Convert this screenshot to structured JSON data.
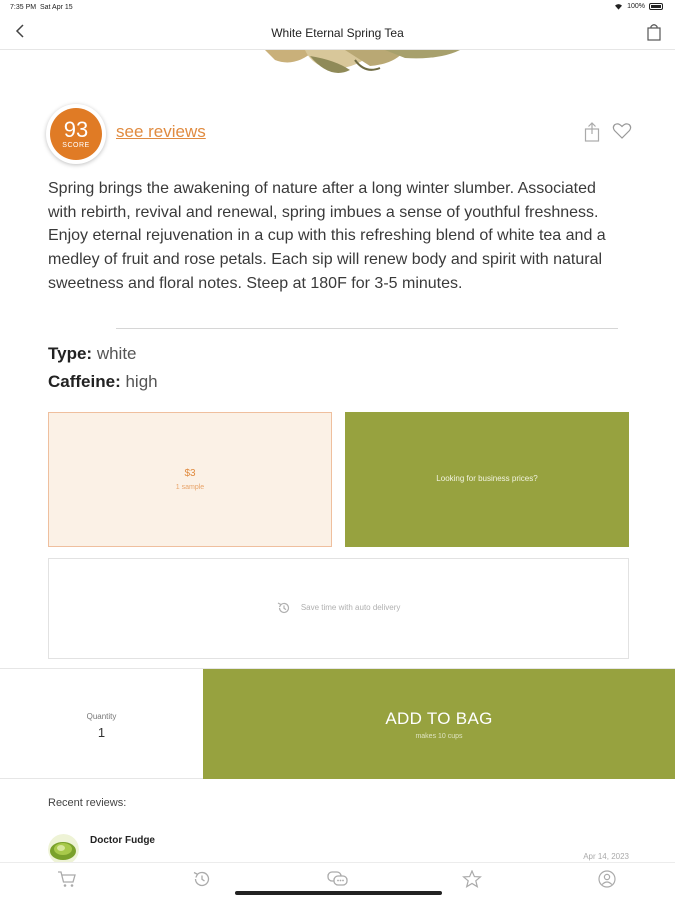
{
  "status": {
    "time": "7:35 PM",
    "date": "Sat Apr 15",
    "battery": "100%"
  },
  "nav": {
    "title": "White Eternal Spring Tea"
  },
  "product": {
    "score": "93",
    "score_label": "SCORE",
    "see_reviews": "see reviews",
    "description": "Spring brings the awakening of nature after a long winter slumber. Associated with rebirth, revival and renewal, spring imbues a sense of youthful freshness. Enjoy eternal rejuvenation in a cup with this refreshing blend of white tea and a medley of fruit and rose petals. Each sip will renew body and spirit with natural sweetness and floral notes. Steep at 180F for 3-5 minutes.",
    "type_label": "Type:",
    "type_value": "white",
    "caffeine_label": "Caffeine:",
    "caffeine_value": "high"
  },
  "pricing": {
    "sample_price": "$3",
    "sample_qty": "1 sample",
    "business_prompt": "Looking for business prices?",
    "auto_delivery": "Save time with auto delivery"
  },
  "cart": {
    "quantity_label": "Quantity",
    "quantity_value": "1",
    "add_label": "ADD TO BAG",
    "add_sub": "makes 10 cups"
  },
  "reviews": {
    "title": "Recent reviews:",
    "items": [
      {
        "name": "Doctor Fudge",
        "date": "Apr 14, 2023"
      }
    ]
  },
  "tabs": [
    {
      "icon": "cart-icon"
    },
    {
      "icon": "history-icon"
    },
    {
      "icon": "chat-icon"
    },
    {
      "icon": "star-icon"
    },
    {
      "icon": "profile-icon"
    }
  ],
  "colors": {
    "accent_orange": "#e07b25",
    "olive": "#97a23f",
    "sample_bg": "#fbf1e6"
  }
}
